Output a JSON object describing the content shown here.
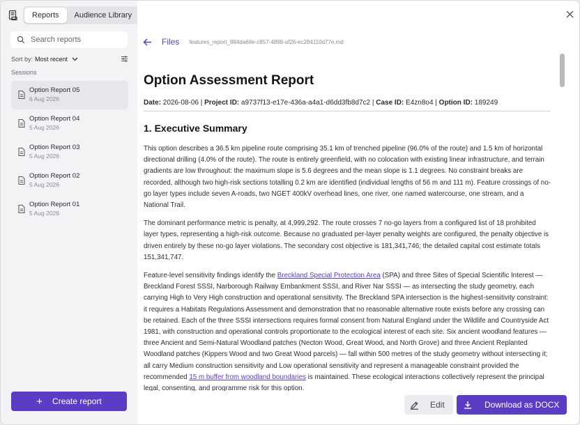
{
  "sidebar": {
    "tabs": [
      {
        "label": "Reports",
        "active": true
      },
      {
        "label": "Audience Library",
        "active": false
      }
    ],
    "search": {
      "placeholder": "Search reports"
    },
    "sort": {
      "label": "Sort by:",
      "value": "Most recent"
    },
    "section_title": "Sessions",
    "sessions": [
      {
        "title": "Option Report 05",
        "date": "6 Aug 2026",
        "active": true
      },
      {
        "title": "Option Report 04",
        "date": "5 Aug 2026",
        "active": false
      },
      {
        "title": "Option Report 03",
        "date": "5 Aug 2026",
        "active": false
      },
      {
        "title": "Option Report 02",
        "date": "5 Aug 2026",
        "active": false
      },
      {
        "title": "Option Report 01",
        "date": "5 Aug 2026",
        "active": false
      }
    ],
    "create_label": "Create report"
  },
  "breadcrumb": {
    "files_label": "Files",
    "file_name": "features_report_884da68e-c857-4898-af26-ec284110d77e.md"
  },
  "document": {
    "title": "Option Assessment Report",
    "meta": {
      "date_label": "Date:",
      "date": "2026-08-06",
      "project_label": "Project ID:",
      "project": "a9737f13-e17e-436a-a4a1-d6dd3fb8d7c2",
      "case_label": "Case ID:",
      "case": "E4zn8o4",
      "option_label": "Option ID:",
      "option": "189249"
    },
    "section_heading": "1. Executive Summary",
    "p1": "This option describes a 36.5 km pipeline route comprising 35.1 km of trenched pipeline (96.0% of the route) and 1.5 km of horizontal directional drilling (4.0% of the route). The route is entirely greenfield, with no colocation with existing linear infrastructure, and terrain gradients are low throughout: the maximum slope is 5.6 degrees and the mean slope is 1.1 degrees. No constraint breaks are recorded, although two high-risk sections totalling 0.2 km are identified (individual lengths of 56 m and 111 m). Feature crossings of no-go layer types include seven A-roads, two NGET 400kV overhead lines, one river, one named watercourse, one stream, and a National Trail.",
    "p2": "The dominant performance metric is penalty, at 4,999,292. The route crosses 7 no-go layers from a configured list of 18 prohibited layer types, representing a high-risk outcome. Because no graduated per-layer penalty weights are configured, the penalty objective is driven entirely by these no-go layer violations. The secondary cost objective is 181,341,746; the detailed capital cost estimate totals 151,341,747.",
    "p3_a": "Feature-level sensitivity findings identify the ",
    "p3_link1": "Breckland Special Protection Area",
    "p3_b": " (SPA) and three Sites of Special Scientific Interest — Breckland Forest SSSI, Narborough Railway Embankment SSSI, and River Nar SSSI — as intersecting the study geometry, each carrying High to Very High construction and operational sensitivity. The Breckland SPA intersection is the highest-sensitivity constraint: it requires a Habitats Regulations Assessment and demonstration that no reasonable alternative route exists before any crossing can be retained. Each of the three SSSI intersections requires formal consent from Natural England under the Wildlife and Countryside Act 1981, with construction and operational controls proportionate to the ecological interest of each site. Six ancient woodland features — three Ancient and Semi-Natural Woodland patches (Necton Wood, Great Wood, and North Grove) and three Ancient Replanted Woodland patches (Kippers Wood and two Great Wood parcels) — fall within 500 metres of the study geometry without intersecting it; all carry Medium construction sensitivity and Low operational sensitivity and represent a manageable constraint provided the recommended ",
    "p3_link2": "15 m buffer from woodland boundaries",
    "p3_c": " is maintained. These ecological interactions collectively represent the principal legal, consenting, and programme risk for this option."
  },
  "actions": {
    "edit_label": "Edit",
    "download_label": "Download as DOCX"
  },
  "colors": {
    "accent": "#5b3cc4",
    "sidebar_bg": "#f3f3f6"
  }
}
